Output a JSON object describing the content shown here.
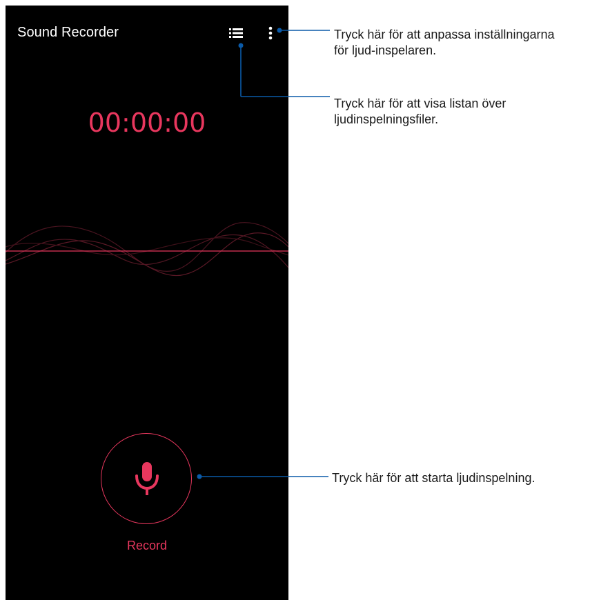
{
  "app": {
    "title": "Sound Recorder",
    "timer": "00:00:00",
    "record_label": "Record"
  },
  "icons": {
    "list": "list-icon",
    "more": "more-vertical-icon",
    "mic": "microphone-icon"
  },
  "colors": {
    "accent": "#e8375e",
    "background": "#000000",
    "callout_line": "#0a5aa8"
  },
  "callouts": {
    "settings": {
      "line1": "Tryck här för att anpassa inställningarna",
      "line2": "för ljud-inspelaren."
    },
    "list": {
      "line1": "Tryck här för att visa listan över",
      "line2": "ljudinspelningsfiler."
    },
    "record": {
      "line1": "Tryck här för att starta ljudinspelning."
    }
  }
}
